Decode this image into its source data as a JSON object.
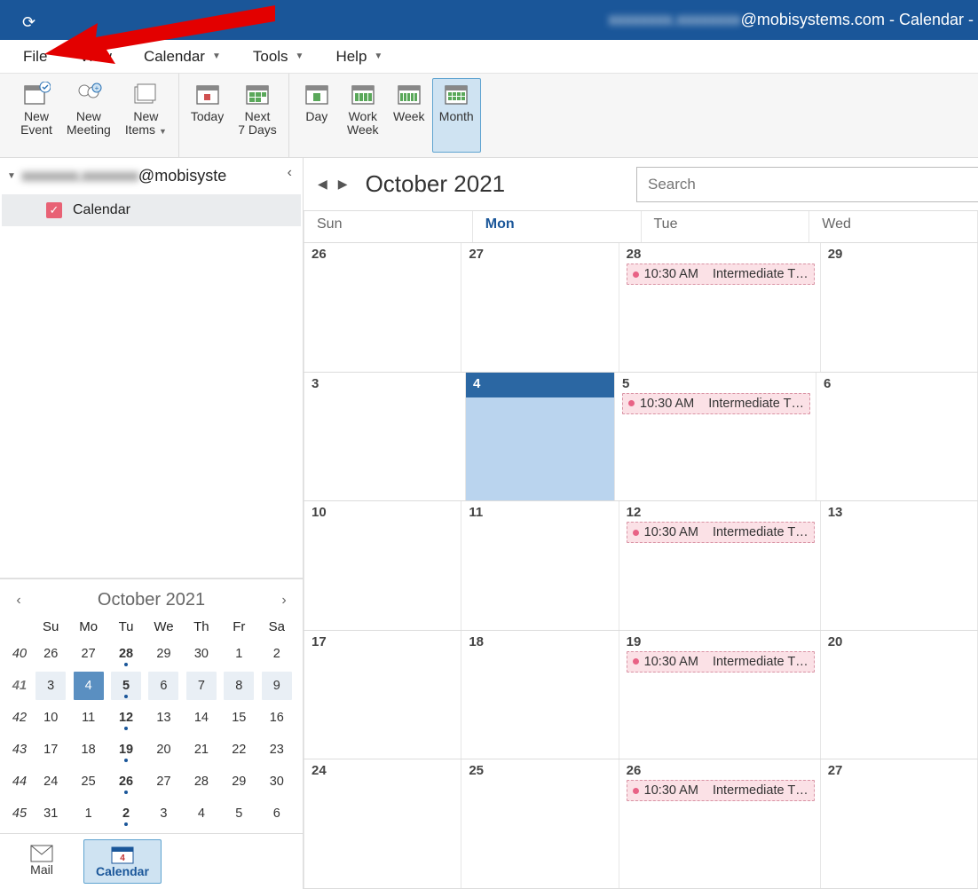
{
  "titlebar": {
    "account_visible": "@mobisystems.com",
    "suffix": " - Calendar -"
  },
  "menus": {
    "file": "File",
    "view": "View",
    "calendar": "Calendar",
    "tools": "Tools",
    "help": "Help"
  },
  "ribbon": {
    "new_event": "New\nEvent",
    "new_meeting": "New\nMeeting",
    "new_items": "New\nItems",
    "today": "Today",
    "next7": "Next\n7 Days",
    "day": "Day",
    "workweek": "Work\nWeek",
    "week": "Week",
    "month": "Month"
  },
  "sidebar": {
    "account_suffix": "@mobisyste",
    "calendar_label": "Calendar",
    "minical": {
      "title": "October 2021",
      "dow": [
        "Su",
        "Mo",
        "Tu",
        "We",
        "Th",
        "Fr",
        "Sa"
      ],
      "weeks": [
        {
          "wk": "40",
          "cur": false,
          "days": [
            {
              "n": "26"
            },
            {
              "n": "27"
            },
            {
              "n": "28",
              "bold": true,
              "dot": true
            },
            {
              "n": "29"
            },
            {
              "n": "30"
            },
            {
              "n": "1"
            },
            {
              "n": "2"
            }
          ]
        },
        {
          "wk": "41",
          "cur": true,
          "days": [
            {
              "n": "3",
              "shade": true
            },
            {
              "n": "4",
              "today": true
            },
            {
              "n": "5",
              "shade": true,
              "bold": true,
              "dot": true
            },
            {
              "n": "6",
              "shade": true
            },
            {
              "n": "7",
              "shade": true
            },
            {
              "n": "8",
              "shade": true
            },
            {
              "n": "9",
              "shade": true
            }
          ]
        },
        {
          "wk": "42",
          "cur": false,
          "days": [
            {
              "n": "10"
            },
            {
              "n": "11"
            },
            {
              "n": "12",
              "bold": true,
              "dot": true
            },
            {
              "n": "13"
            },
            {
              "n": "14"
            },
            {
              "n": "15"
            },
            {
              "n": "16"
            }
          ]
        },
        {
          "wk": "43",
          "cur": false,
          "days": [
            {
              "n": "17"
            },
            {
              "n": "18"
            },
            {
              "n": "19",
              "bold": true,
              "dot": true
            },
            {
              "n": "20"
            },
            {
              "n": "21"
            },
            {
              "n": "22"
            },
            {
              "n": "23"
            }
          ]
        },
        {
          "wk": "44",
          "cur": false,
          "days": [
            {
              "n": "24"
            },
            {
              "n": "25"
            },
            {
              "n": "26",
              "bold": true,
              "dot": true
            },
            {
              "n": "27"
            },
            {
              "n": "28"
            },
            {
              "n": "29"
            },
            {
              "n": "30"
            }
          ]
        },
        {
          "wk": "45",
          "cur": false,
          "days": [
            {
              "n": "31"
            },
            {
              "n": "1"
            },
            {
              "n": "2",
              "bold": true,
              "dot": true
            },
            {
              "n": "3"
            },
            {
              "n": "4"
            },
            {
              "n": "5"
            },
            {
              "n": "6"
            }
          ]
        }
      ]
    },
    "nav": {
      "mail": "Mail",
      "calendar": "Calendar",
      "cal_icon_day": "4"
    }
  },
  "main": {
    "title": "October 2021",
    "search_placeholder": "Search",
    "weekdays": [
      {
        "label": "Sun",
        "today": false
      },
      {
        "label": "Mon",
        "today": true
      },
      {
        "label": "Tue",
        "today": false
      },
      {
        "label": "Wed",
        "today": false
      }
    ],
    "event_time": "10:30 AM",
    "event_title": "Intermediate T…",
    "rows": [
      {
        "cells": [
          {
            "n": "26"
          },
          {
            "n": "27"
          },
          {
            "n": "28",
            "event": true
          },
          {
            "n": "29"
          }
        ]
      },
      {
        "cells": [
          {
            "n": "3"
          },
          {
            "n": "4",
            "today": true
          },
          {
            "n": "5",
            "event": true
          },
          {
            "n": "6"
          }
        ]
      },
      {
        "cells": [
          {
            "n": "10"
          },
          {
            "n": "11"
          },
          {
            "n": "12",
            "event": true
          },
          {
            "n": "13"
          }
        ]
      },
      {
        "cells": [
          {
            "n": "17"
          },
          {
            "n": "18"
          },
          {
            "n": "19",
            "event": true
          },
          {
            "n": "20"
          }
        ]
      },
      {
        "cells": [
          {
            "n": "24"
          },
          {
            "n": "25"
          },
          {
            "n": "26",
            "event": true
          },
          {
            "n": "27"
          }
        ]
      }
    ]
  }
}
